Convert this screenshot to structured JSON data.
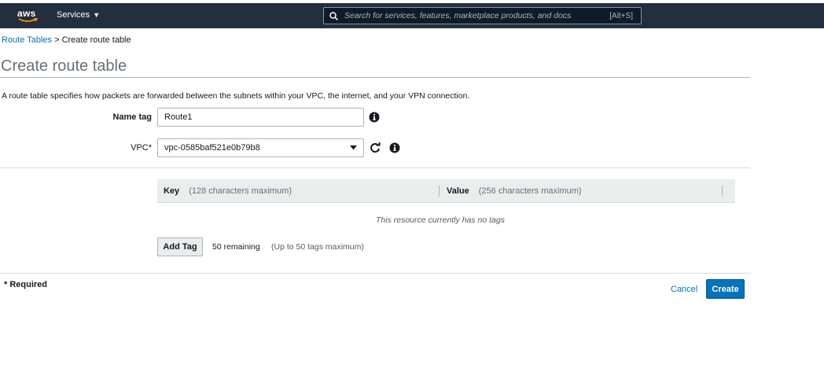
{
  "nav": {
    "logo_text": "aws",
    "services_label": "Services",
    "search_placeholder": "Search for services, features, marketplace products, and docs",
    "search_shortcut": "[Alt+S]"
  },
  "breadcrumb": {
    "parent": "Route Tables",
    "separator": " > ",
    "current": "Create route table"
  },
  "page": {
    "title": "Create route table",
    "description": "A route table specifies how packets are forwarded between the subnets within your VPC, the internet, and your VPN connection."
  },
  "form": {
    "name_tag_label": "Name tag",
    "name_tag_value": "Route1",
    "vpc_label": "VPC*",
    "vpc_value": "vpc-0585baf521e0b79b8"
  },
  "tags": {
    "key_header": "Key",
    "key_hint": "(128 characters maximum)",
    "value_header": "Value",
    "value_hint": "(256 characters maximum)",
    "empty_message": "This resource currently has no tags",
    "add_tag_label": "Add Tag",
    "remaining": "50 remaining",
    "max_note": "(Up to 50 tags maximum)"
  },
  "footer": {
    "required_note": "* Required",
    "cancel_label": "Cancel",
    "create_label": "Create"
  },
  "colors": {
    "nav_bg": "#232f3e",
    "link": "#0073bb",
    "primary_button": "#0073bb",
    "aws_smile": "#ff9900"
  }
}
